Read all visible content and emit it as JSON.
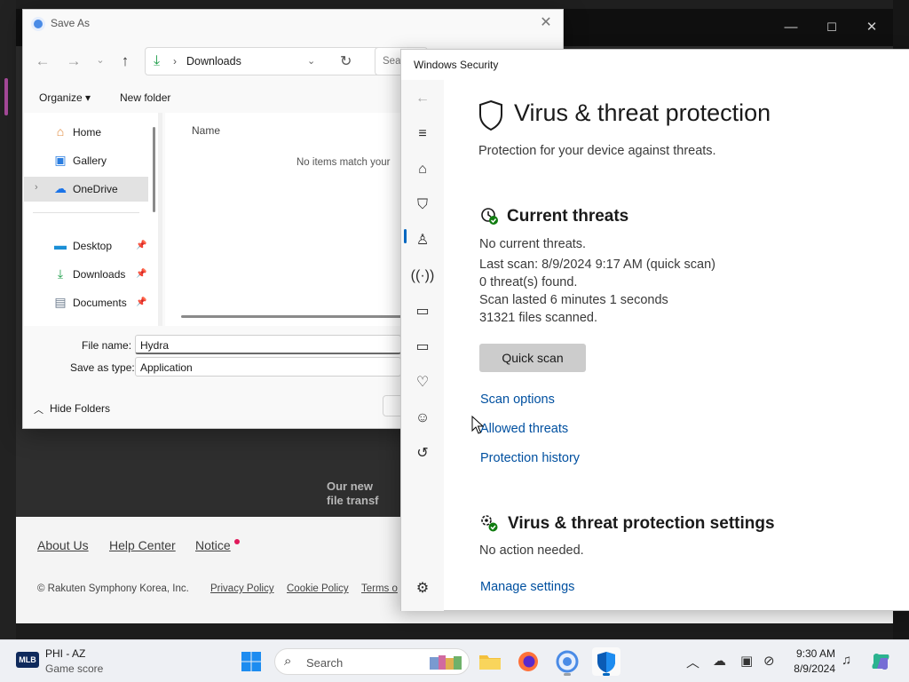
{
  "background_window": {
    "controls": [
      "—",
      "☐",
      "✕"
    ],
    "blur_text": [
      "Our new",
      "file transf"
    ],
    "footer_links": [
      "About Us",
      "Help Center",
      "Notice"
    ],
    "copyright": "© Rakuten Symphony Korea, Inc.",
    "footer_small_links": [
      "Privacy Policy",
      "Cookie Policy",
      "Terms o"
    ]
  },
  "save_as": {
    "title": "Save As",
    "close": "✕",
    "address": "Downloads",
    "search_placeholder": "Sear",
    "toolbar": {
      "organize": "Organize ▾",
      "new_folder": "New folder"
    },
    "sidebar": [
      {
        "label": "Home",
        "icon": "home-icon"
      },
      {
        "label": "Gallery",
        "icon": "gallery-icon"
      },
      {
        "label": "OneDrive",
        "icon": "onedrive-icon",
        "selected": true
      },
      {
        "label": "Desktop",
        "icon": "desktop-icon",
        "pinned": true
      },
      {
        "label": "Downloads",
        "icon": "downloads-icon",
        "pinned": true
      },
      {
        "label": "Documents",
        "icon": "documents-icon",
        "pinned": true
      }
    ],
    "column_name": "Name",
    "empty_message": "No items match your",
    "file_name_label": "File name:",
    "file_name_value": "Hydra",
    "save_type_label": "Save as type:",
    "save_type_value": "Application",
    "hide_folders": "Hide Folders"
  },
  "windows_security": {
    "window_title": "Windows Security",
    "page_title": "Virus & threat protection",
    "subtitle": "Protection for your device against threats.",
    "current_threats": {
      "heading": "Current threats",
      "status": "No current threats.",
      "last_scan": "Last scan: 8/9/2024 9:17 AM (quick scan)",
      "threats_found": "0 threat(s) found.",
      "duration": "Scan lasted 6 minutes 1 seconds",
      "files_scanned": "31321 files scanned.",
      "quick_scan_button": "Quick scan",
      "links": [
        "Scan options",
        "Allowed threats",
        "Protection history"
      ]
    },
    "settings": {
      "heading": "Virus & threat protection settings",
      "status": "No action needed.",
      "manage_link": "Manage settings"
    },
    "colors": {
      "accent": "#0067c0",
      "link": "#0050a0",
      "ok_green": "#107c10"
    }
  },
  "taskbar": {
    "weather_line1": "PHI - AZ",
    "weather_line2": "Game score",
    "weather_badge": "MLB",
    "search_label": "Search",
    "time": "9:30 AM",
    "date": "8/9/2024"
  }
}
